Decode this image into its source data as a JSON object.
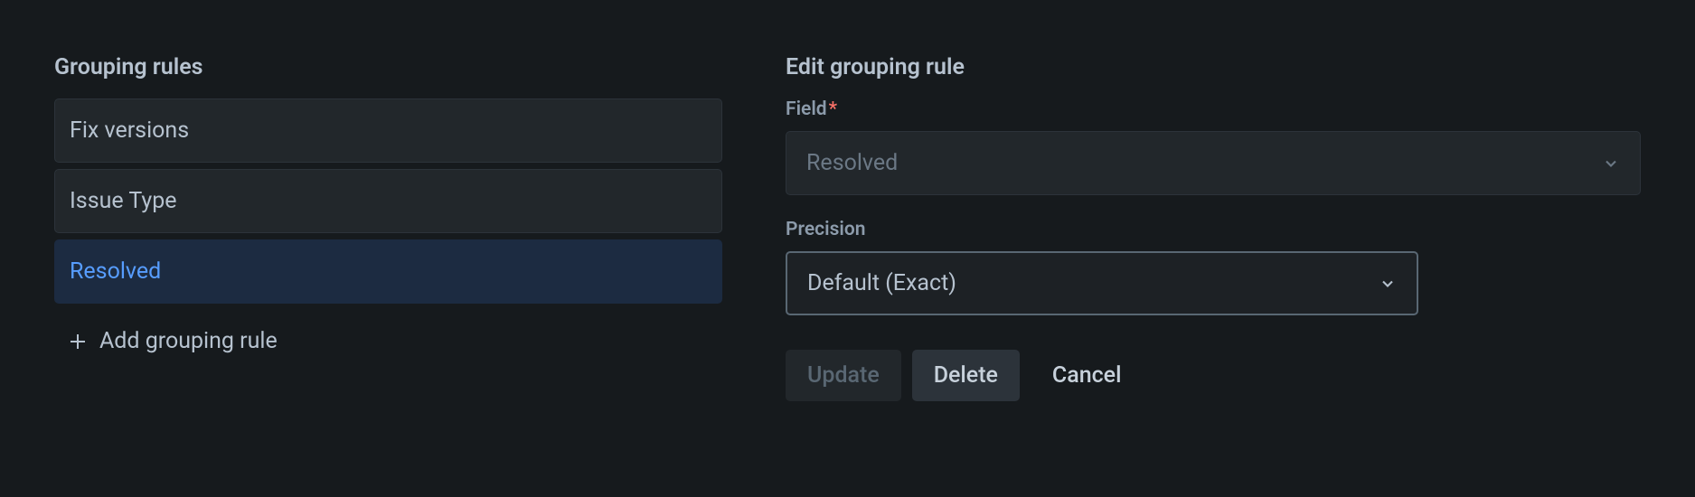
{
  "left": {
    "title": "Grouping rules",
    "rules": [
      {
        "label": "Fix versions",
        "selected": false
      },
      {
        "label": "Issue Type",
        "selected": false
      },
      {
        "label": "Resolved",
        "selected": true
      }
    ],
    "add_label": "Add grouping rule"
  },
  "right": {
    "title": "Edit grouping rule",
    "field_label": "Field",
    "field_value": "Resolved",
    "precision_label": "Precision",
    "precision_value": "Default (Exact)",
    "buttons": {
      "update": "Update",
      "delete": "Delete",
      "cancel": "Cancel"
    }
  }
}
